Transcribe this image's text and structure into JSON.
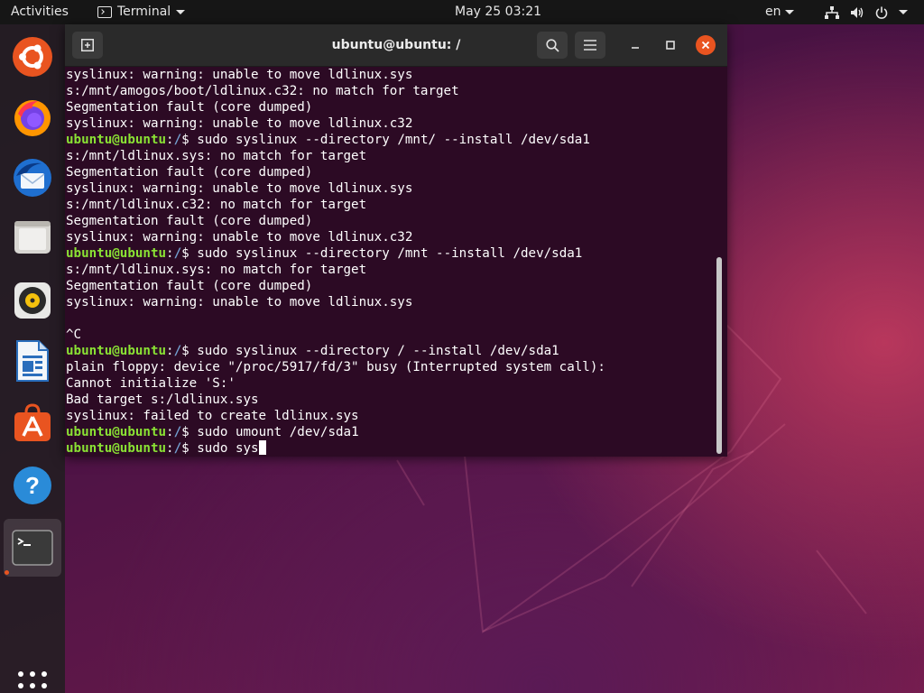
{
  "topbar": {
    "activities": "Activities",
    "app_menu_label": "Terminal",
    "clock": "May 25  03:21",
    "language": "en"
  },
  "dock": {
    "items": [
      {
        "name": "ubuntu-installer-icon"
      },
      {
        "name": "firefox-icon"
      },
      {
        "name": "thunderbird-icon"
      },
      {
        "name": "files-icon"
      },
      {
        "name": "rhythmbox-icon"
      },
      {
        "name": "libreoffice-writer-icon"
      },
      {
        "name": "ubuntu-software-icon"
      },
      {
        "name": "help-icon"
      },
      {
        "name": "terminal-icon"
      }
    ],
    "show_apps_icon": "grid-icon"
  },
  "terminal": {
    "title": "ubuntu@ubuntu: /",
    "prompt_user": "ubuntu@ubuntu",
    "prompt_sep": ":",
    "prompt_path": "/",
    "prompt_symbol": "$ ",
    "lines": [
      {
        "type": "out",
        "text": "syslinux: warning: unable to move ldlinux.sys"
      },
      {
        "type": "out",
        "text": "s:/mnt/amogos/boot/ldlinux.c32: no match for target"
      },
      {
        "type": "out",
        "text": "Segmentation fault (core dumped)"
      },
      {
        "type": "out",
        "text": "syslinux: warning: unable to move ldlinux.c32"
      },
      {
        "type": "cmd",
        "text": "sudo syslinux --directory /mnt/ --install /dev/sda1"
      },
      {
        "type": "out",
        "text": "s:/mnt/ldlinux.sys: no match for target"
      },
      {
        "type": "out",
        "text": "Segmentation fault (core dumped)"
      },
      {
        "type": "out",
        "text": "syslinux: warning: unable to move ldlinux.sys"
      },
      {
        "type": "out",
        "text": "s:/mnt/ldlinux.c32: no match for target"
      },
      {
        "type": "out",
        "text": "Segmentation fault (core dumped)"
      },
      {
        "type": "out",
        "text": "syslinux: warning: unable to move ldlinux.c32"
      },
      {
        "type": "cmd",
        "text": "sudo syslinux --directory /mnt --install /dev/sda1"
      },
      {
        "type": "out",
        "text": "s:/mnt/ldlinux.sys: no match for target"
      },
      {
        "type": "out",
        "text": "Segmentation fault (core dumped)"
      },
      {
        "type": "out",
        "text": "syslinux: warning: unable to move ldlinux.sys"
      },
      {
        "type": "out",
        "text": ""
      },
      {
        "type": "out",
        "text": "^C"
      },
      {
        "type": "cmd",
        "text": "sudo syslinux --directory / --install /dev/sda1"
      },
      {
        "type": "out",
        "text": "plain floppy: device \"/proc/5917/fd/3\" busy (Interrupted system call):"
      },
      {
        "type": "out",
        "text": "Cannot initialize 'S:'"
      },
      {
        "type": "out",
        "text": "Bad target s:/ldlinux.sys"
      },
      {
        "type": "out",
        "text": "syslinux: failed to create ldlinux.sys"
      },
      {
        "type": "cmd",
        "text": "sudo umount /dev/sda1"
      },
      {
        "type": "input",
        "text": "sudo sys"
      }
    ]
  }
}
